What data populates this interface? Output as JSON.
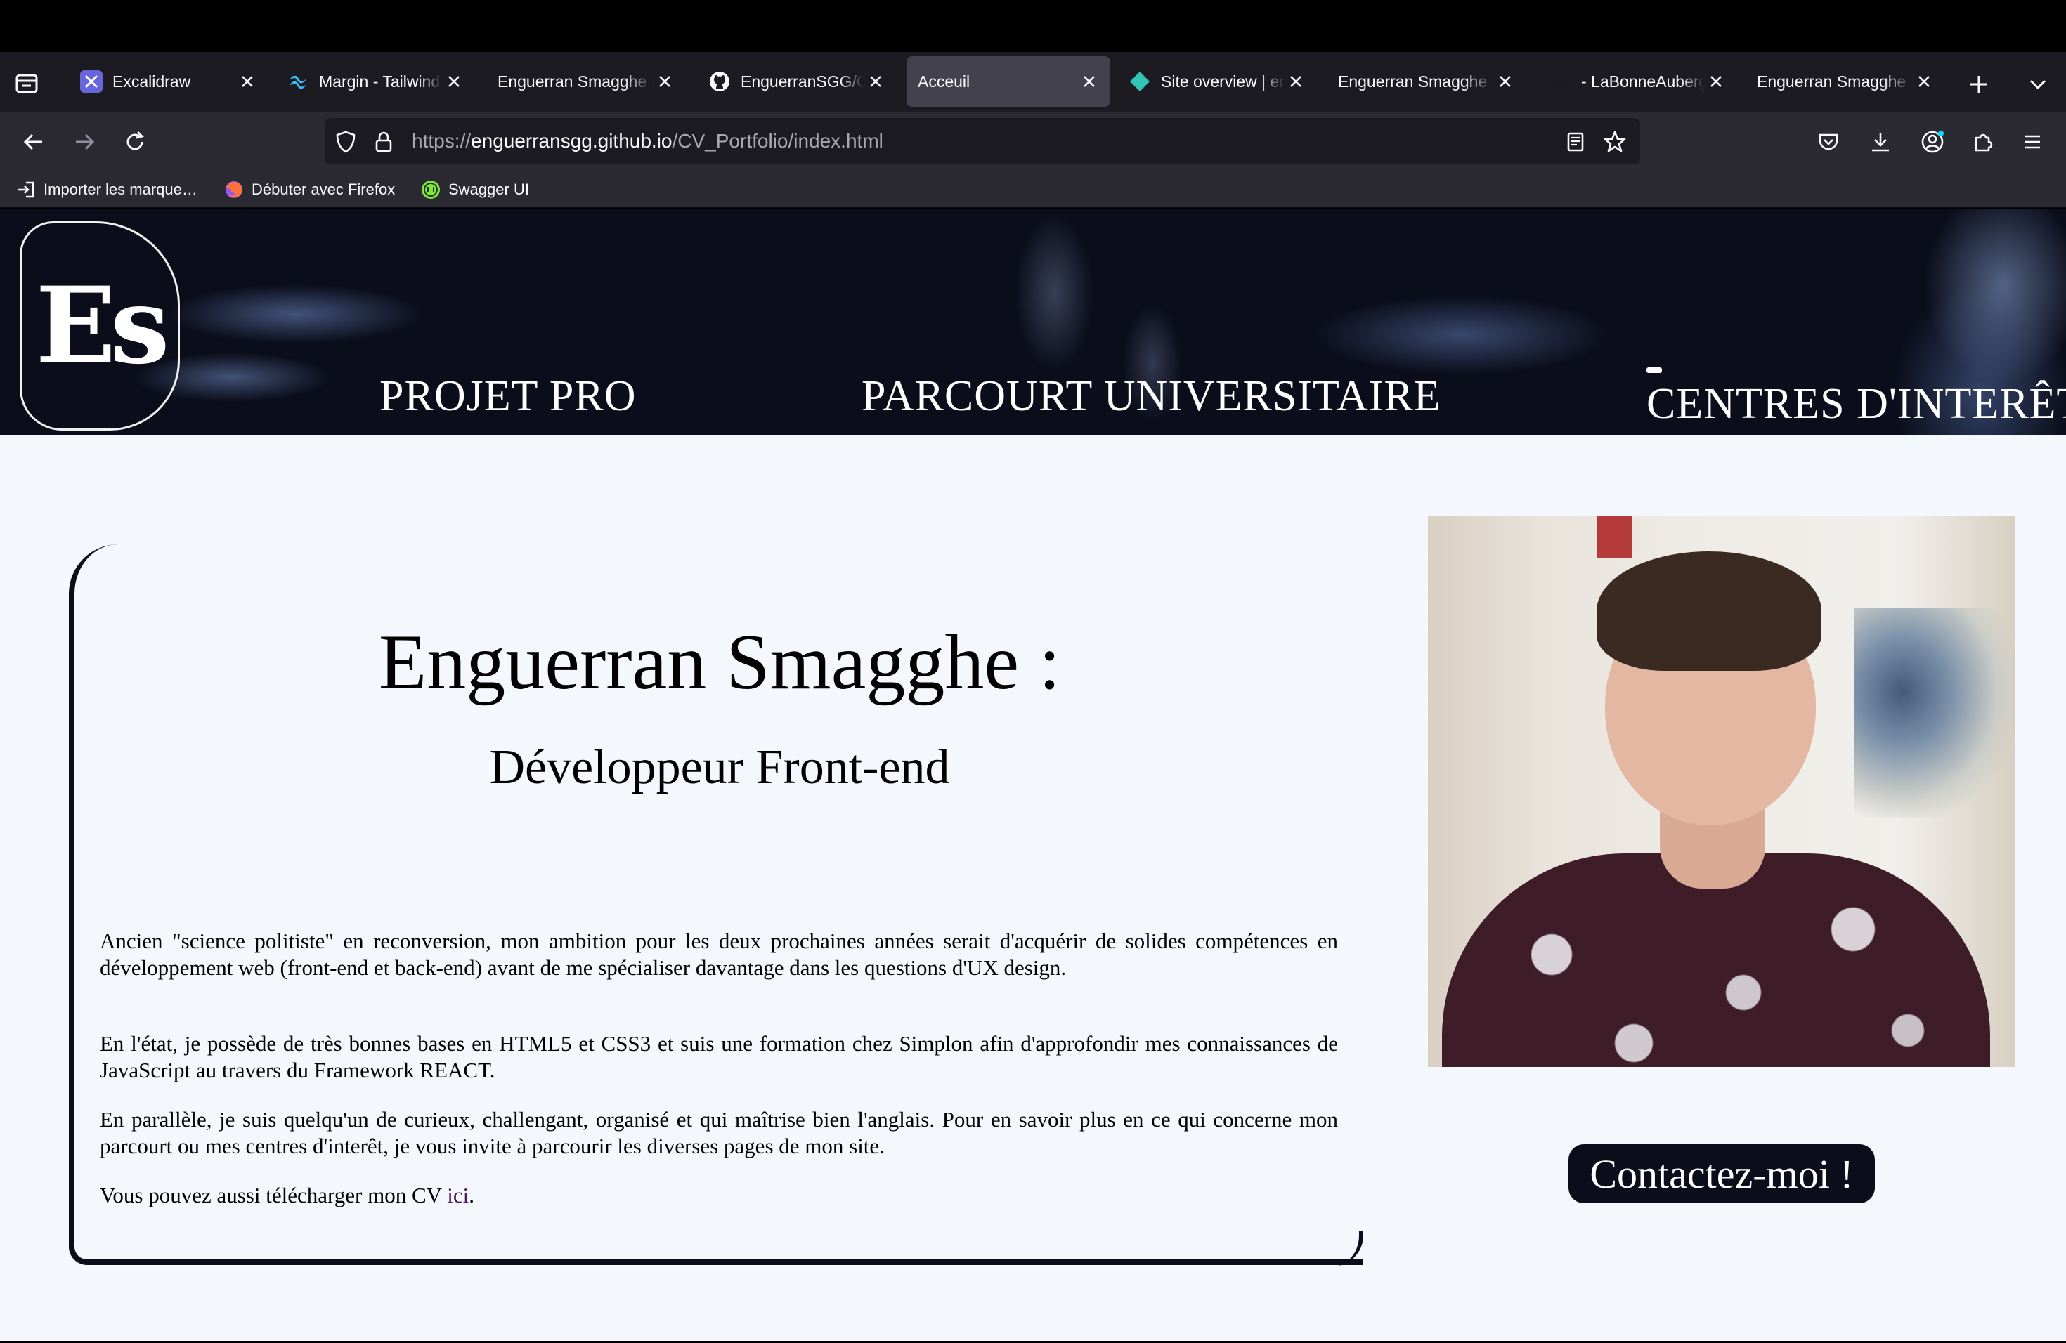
{
  "browser": {
    "tabs": [
      {
        "title": "Excalidraw",
        "icon": "excalidraw-icon",
        "active": false
      },
      {
        "title": "Margin - Tailwind CSS",
        "icon": "tailwind-icon",
        "active": false
      },
      {
        "title": "Enguerran Smagghe | Portfolio",
        "icon": "",
        "active": false
      },
      {
        "title": "EnguerranSGG/CV_Portfolio",
        "icon": "github-icon",
        "active": false
      },
      {
        "title": "Acceuil",
        "icon": "",
        "active": true
      },
      {
        "title": "Site overview | enguerransgg",
        "icon": "netlify-icon",
        "active": false
      },
      {
        "title": "Enguerran Smagghe | Portfolio",
        "icon": "",
        "active": false
      },
      {
        "title": "- LaBonneAuberge",
        "icon": "site-icon",
        "active": false
      },
      {
        "title": "Enguerran Smagghe | Portfolio",
        "icon": "",
        "active": false
      }
    ],
    "url": {
      "scheme": "https://",
      "host": "enguerransgg.github.io",
      "path": "/CV_Portfolio/index.html"
    },
    "bookmarks": [
      {
        "label": "Importer les marque…",
        "icon": "import-icon"
      },
      {
        "label": "Débuter avec Firefox",
        "icon": "firefox-icon"
      },
      {
        "label": "Swagger UI",
        "icon": "swagger-icon"
      }
    ]
  },
  "site": {
    "logo_text": "Es",
    "nav": {
      "projet": "PROJET PRO",
      "parcours": "PARCOURT UNIVERSITAIRE",
      "interets": "CENTRES D'INTERÊT"
    },
    "name": "Enguerran Smagghe :",
    "role": "Développeur Front-end",
    "paragraphs": {
      "p1": "Ancien \"science politiste\" en reconversion, mon ambition pour les deux prochaines années serait d'acquérir de solides compétences en développement web (front-end et back-end) avant de me spécialiser davantage dans les questions d'UX design.",
      "p2": "En l'état, je possède de très bonnes bases en HTML5 et CSS3 et suis une formation chez Simplon afin d'approfondir mes connaissances de JavaScript au travers du Framework REACT.",
      "p3": "En parallèle, je suis quelqu'un de curieux, challengant, organisé et qui maîtrise bien l'anglais. Pour en savoir plus en ce qui concerne mon parcourt ou mes centres d'interêt, je vous invite à parcourir les diverses pages de mon site.",
      "p4_prefix": "Vous pouvez aussi télécharger mon CV ",
      "p4_link": "ici",
      "p4_suffix": "."
    },
    "contact_label": "Contactez-moi !"
  },
  "colors": {
    "tabbar_bg": "#1c1b22",
    "toolbar_bg": "#2b2a33",
    "page_bg": "#f4f8fd",
    "banner_bg": "#0b0d1a",
    "link": "#4b1560"
  }
}
